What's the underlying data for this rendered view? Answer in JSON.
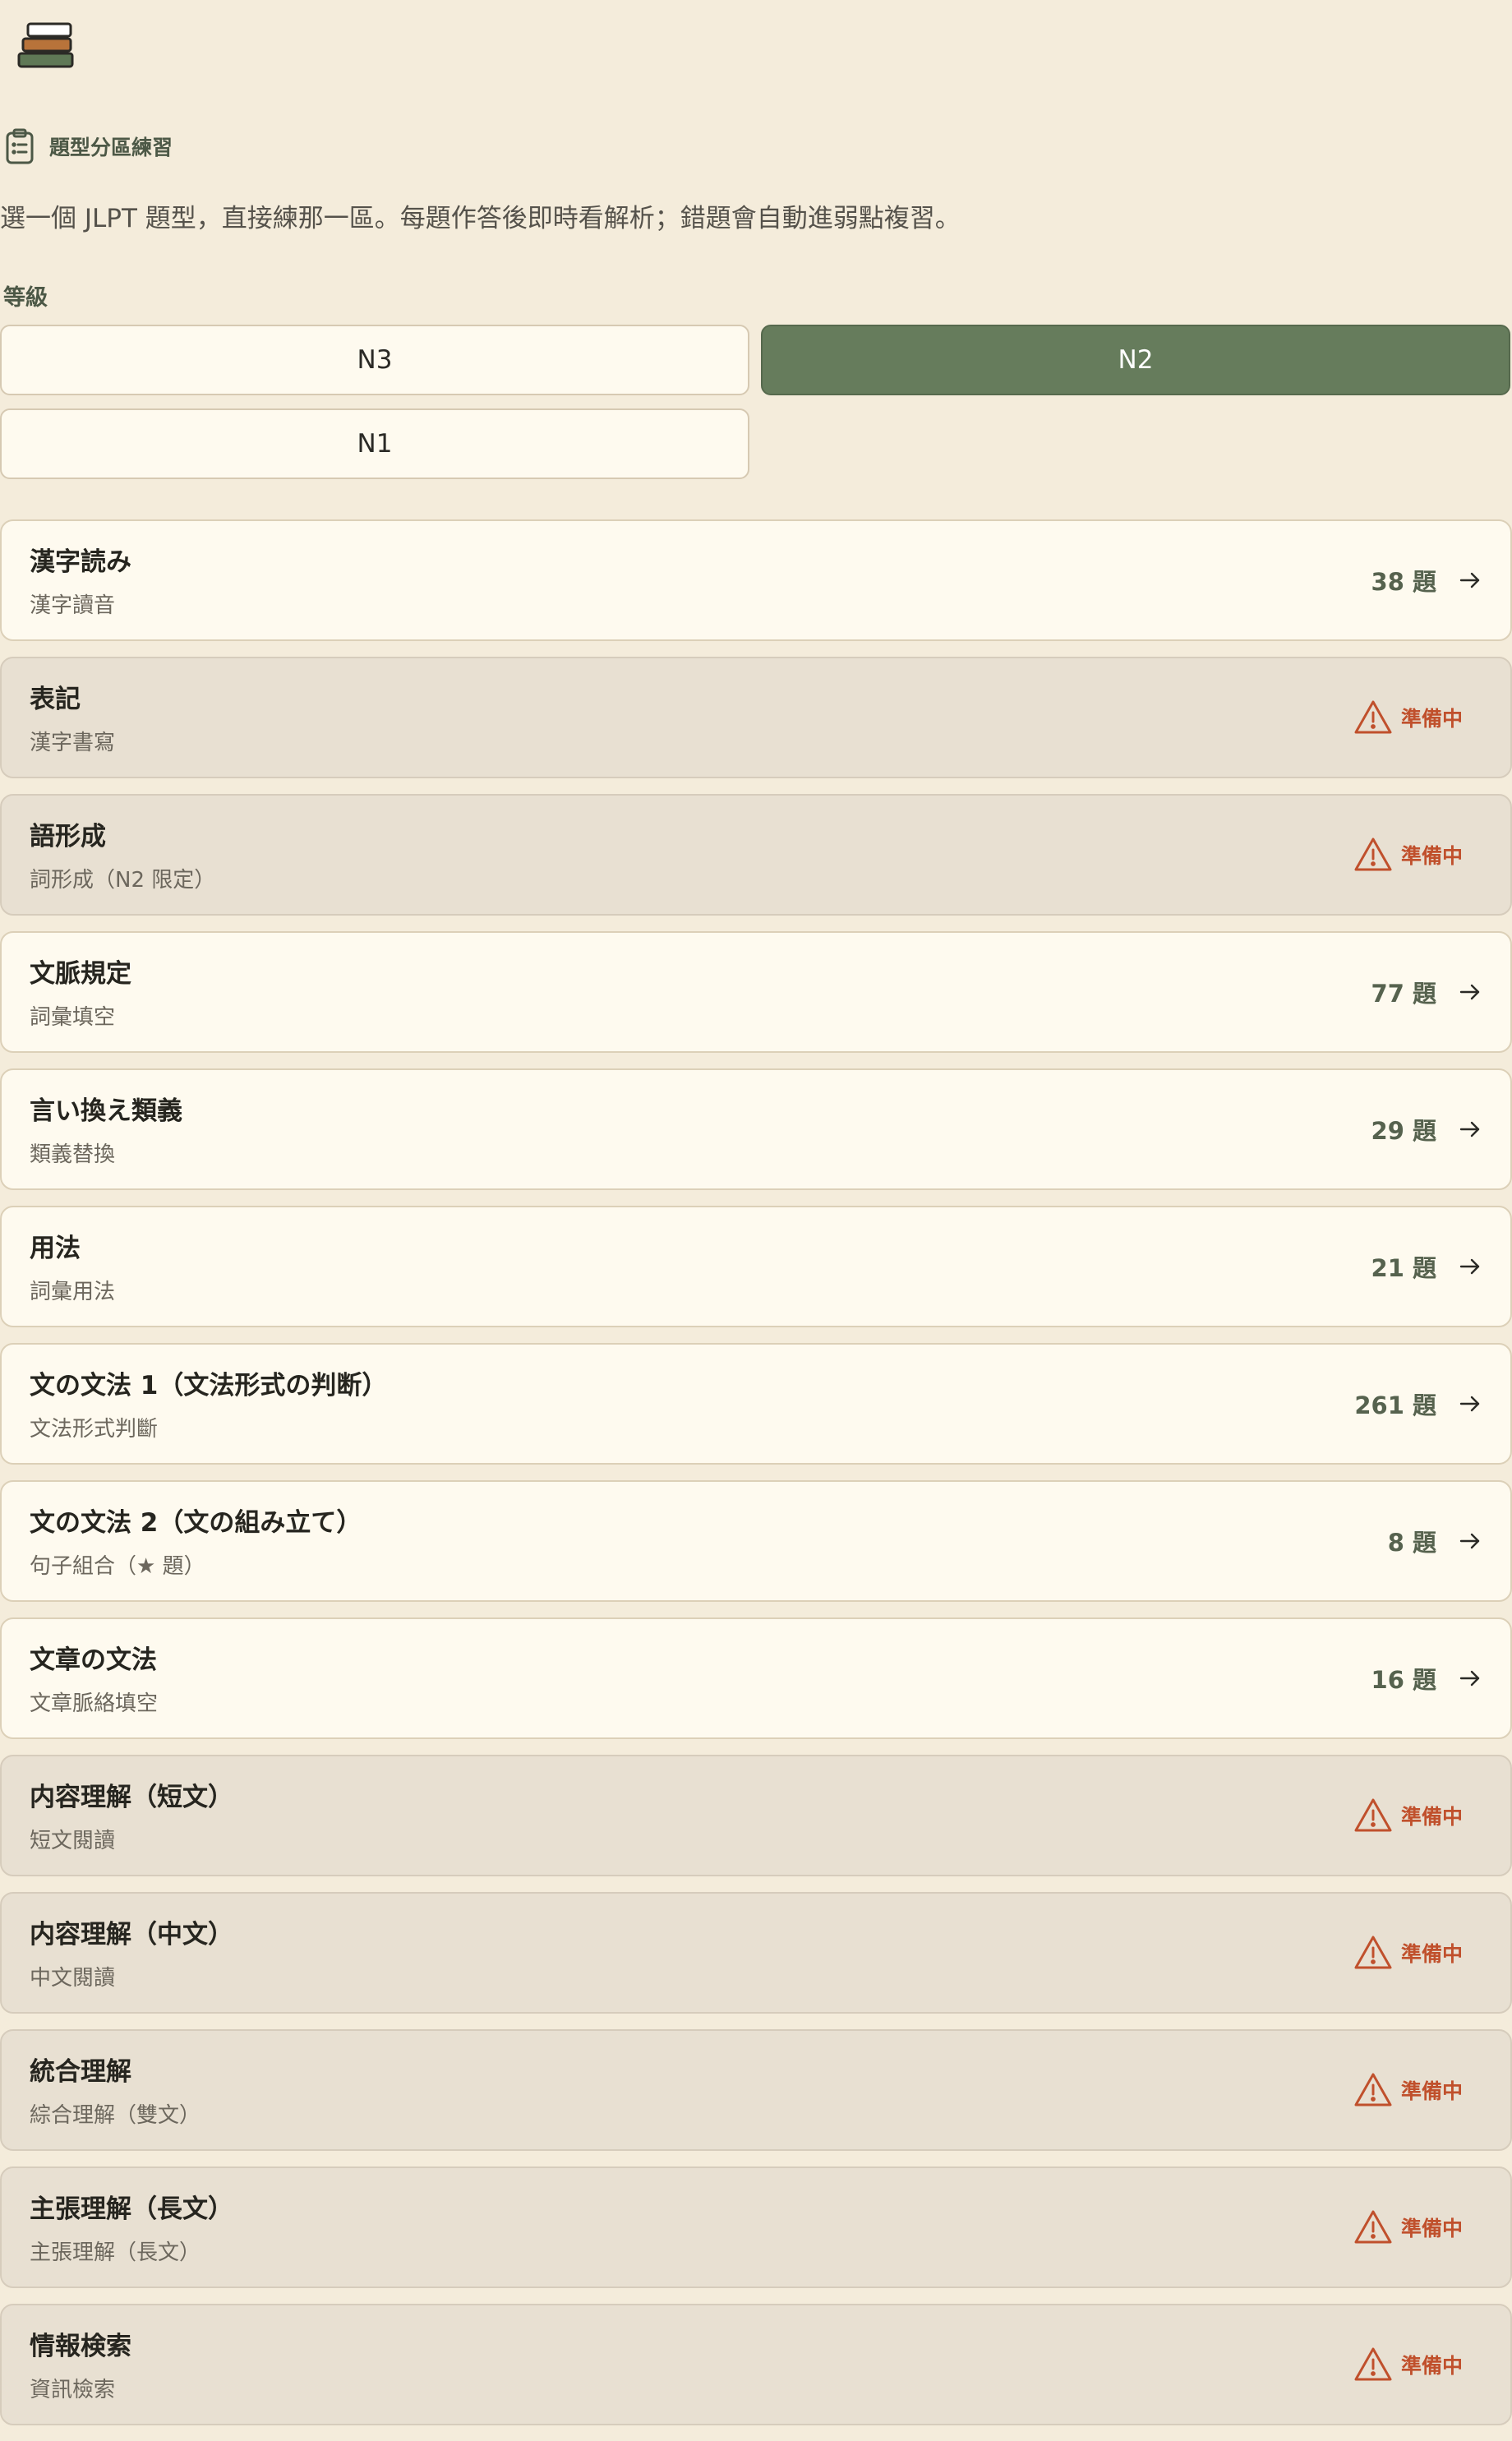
{
  "app": {
    "logo_icon": "stacked-books-icon"
  },
  "section": {
    "title": "題型分區練習",
    "icon": "clipboard-list-icon",
    "description": "選一個 JLPT 題型，直接練那一區。每題作答後即時看解析；錯題會自動進弱點複習。"
  },
  "levels": {
    "label": "等級",
    "options": [
      "N3",
      "N2",
      "N1"
    ],
    "selected": "N2"
  },
  "categories": [
    {
      "title": "漢字読み",
      "subtitle": "漢字讀音",
      "count": "38 題",
      "status": "available"
    },
    {
      "title": "表記",
      "subtitle": "漢字書寫",
      "status_label": "準備中",
      "status": "pending"
    },
    {
      "title": "語形成",
      "subtitle": "詞形成（N2 限定）",
      "status_label": "準備中",
      "status": "pending"
    },
    {
      "title": "文脈規定",
      "subtitle": "詞彙填空",
      "count": "77 題",
      "status": "available"
    },
    {
      "title": "言い換え類義",
      "subtitle": "類義替換",
      "count": "29 題",
      "status": "available"
    },
    {
      "title": "用法",
      "subtitle": "詞彙用法",
      "count": "21 題",
      "status": "available"
    },
    {
      "title": "文の文法 1（文法形式の判断）",
      "subtitle": "文法形式判斷",
      "count": "261 題",
      "status": "available"
    },
    {
      "title": "文の文法 2（文の組み立て）",
      "subtitle": "句子組合（★ 題）",
      "count": "8 題",
      "status": "available"
    },
    {
      "title": "文章の文法",
      "subtitle": "文章脈絡填空",
      "count": "16 題",
      "status": "available"
    },
    {
      "title": "内容理解（短文）",
      "subtitle": "短文閱讀",
      "status_label": "準備中",
      "status": "pending"
    },
    {
      "title": "内容理解（中文）",
      "subtitle": "中文閱讀",
      "status_label": "準備中",
      "status": "pending"
    },
    {
      "title": "統合理解",
      "subtitle": "綜合理解（雙文）",
      "status_label": "準備中",
      "status": "pending"
    },
    {
      "title": "主張理解（長文）",
      "subtitle": "主張理解（長文）",
      "status_label": "準備中",
      "status": "pending"
    },
    {
      "title": "情報検索",
      "subtitle": "資訊檢索",
      "status_label": "準備中",
      "status": "pending"
    }
  ],
  "icons": {
    "available": "arrow-right-icon",
    "pending": "warning-icon"
  },
  "colors": {
    "background": "#f4ecdb",
    "accent_green": "#667c5c",
    "pending_red": "#c0502c",
    "card_bg": "#fefaef",
    "pending_card_bg": "#e8e0d2"
  }
}
